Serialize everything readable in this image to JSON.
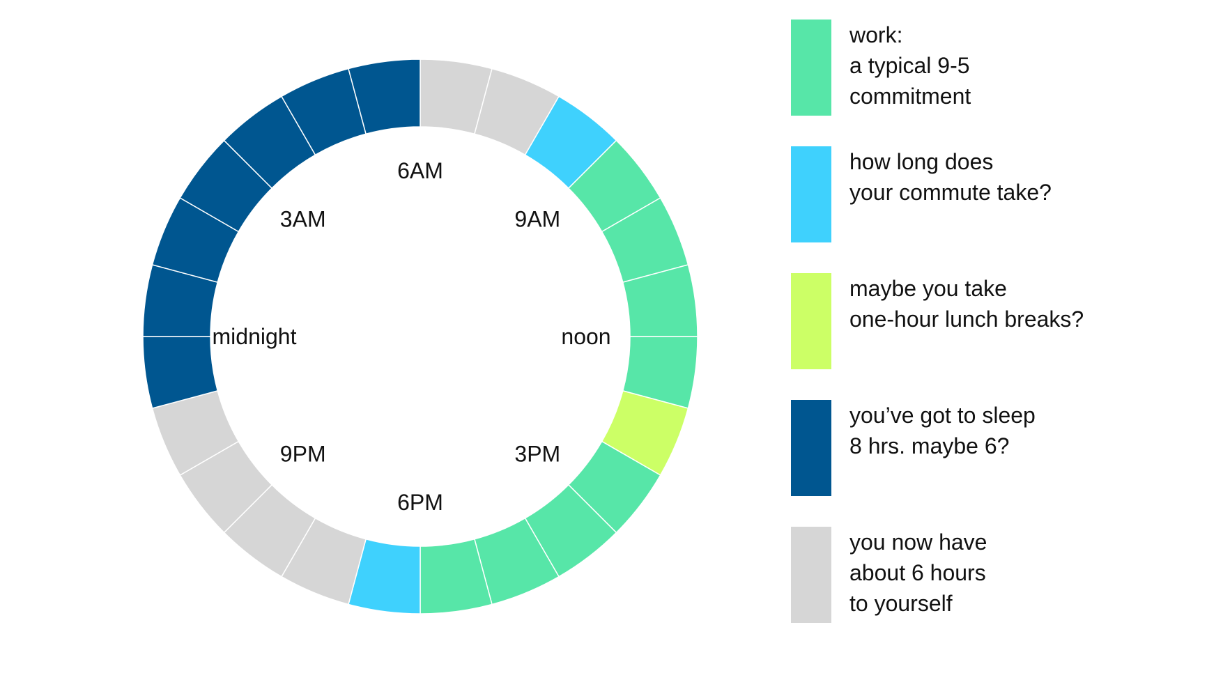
{
  "chart_data": {
    "type": "donut",
    "hours_per_segment": 1,
    "start_hour_label": "6AM",
    "direction": "clockwise",
    "segments": [
      {
        "hour": "6AM",
        "category": "free"
      },
      {
        "hour": "7AM",
        "category": "free"
      },
      {
        "hour": "8AM",
        "category": "commute"
      },
      {
        "hour": "9AM",
        "category": "work"
      },
      {
        "hour": "10AM",
        "category": "work"
      },
      {
        "hour": "11AM",
        "category": "work"
      },
      {
        "hour": "noon",
        "category": "work"
      },
      {
        "hour": "1PM",
        "category": "lunch"
      },
      {
        "hour": "2PM",
        "category": "work"
      },
      {
        "hour": "3PM",
        "category": "work"
      },
      {
        "hour": "4PM",
        "category": "work"
      },
      {
        "hour": "5PM",
        "category": "work"
      },
      {
        "hour": "6PM",
        "category": "commute"
      },
      {
        "hour": "7PM",
        "category": "free"
      },
      {
        "hour": "8PM",
        "category": "free"
      },
      {
        "hour": "9PM",
        "category": "free"
      },
      {
        "hour": "10PM",
        "category": "free"
      },
      {
        "hour": "11PM",
        "category": "sleep"
      },
      {
        "hour": "midnight",
        "category": "sleep"
      },
      {
        "hour": "1AM",
        "category": "sleep"
      },
      {
        "hour": "2AM",
        "category": "sleep"
      },
      {
        "hour": "3AM",
        "category": "sleep"
      },
      {
        "hour": "4AM",
        "category": "sleep"
      },
      {
        "hour": "5AM",
        "category": "sleep"
      }
    ],
    "hour_labels": [
      {
        "text": "6AM",
        "hour_index": 0
      },
      {
        "text": "9AM",
        "hour_index": 3
      },
      {
        "text": "noon",
        "hour_index": 6
      },
      {
        "text": "3PM",
        "hour_index": 9
      },
      {
        "text": "6PM",
        "hour_index": 12
      },
      {
        "text": "9PM",
        "hour_index": 15
      },
      {
        "text": "midnight",
        "hour_index": 18
      },
      {
        "text": "3AM",
        "hour_index": 21
      }
    ],
    "legend": [
      {
        "category": "work",
        "text": "work:\na typical 9-5\ncommitment",
        "color": "#57E6A8"
      },
      {
        "category": "commute",
        "text": "how long does\nyour commute take?",
        "color": "#3FD1FD"
      },
      {
        "category": "lunch",
        "text": "maybe you take\none-hour lunch breaks?",
        "color": "#CCFF66"
      },
      {
        "category": "sleep",
        "text": "you’ve got to sleep\n8 hrs. maybe 6?",
        "color": "#005690"
      },
      {
        "category": "free",
        "text": "you now have\nabout 6 hours\nto yourself",
        "color": "#D6D6D6"
      }
    ]
  }
}
